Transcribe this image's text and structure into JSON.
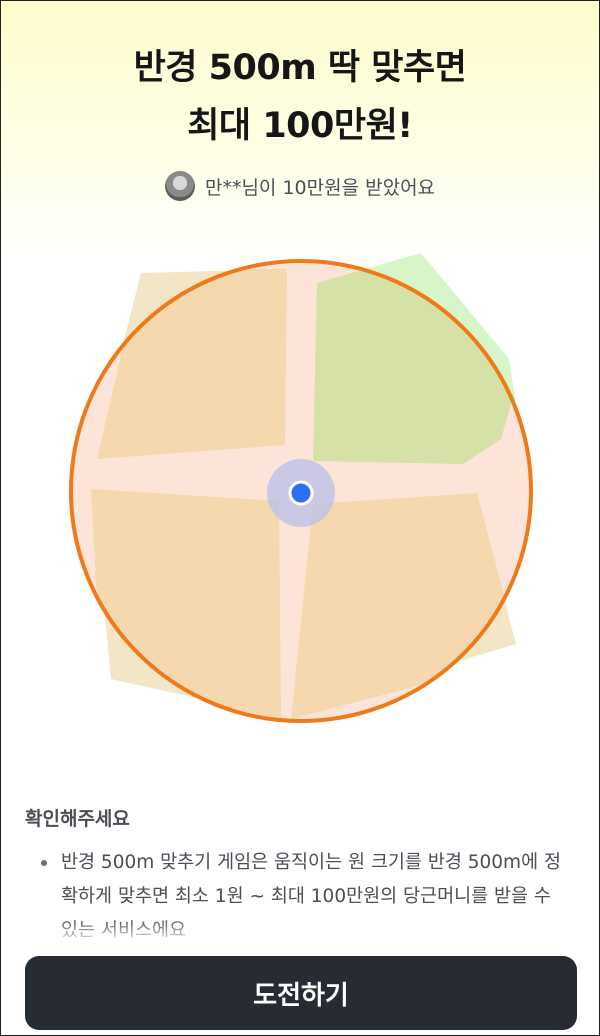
{
  "header": {
    "title_line1": "반경 500m 딱 맞추면",
    "title_line2": "최대 100만원!"
  },
  "winner": {
    "message": "만**님이 10만원을 받았어요"
  },
  "info": {
    "section_title": "확인해주세요",
    "notice": "반경 500m 맞추기 게임은 움직이는 원 크기를 반경 500m에 정확하게 맞추면 최소 1원 ~ 최대 100만원의 당근머니를 받을 수 있는 서비스에요"
  },
  "cta": {
    "label": "도전하기"
  },
  "colors": {
    "circle_stroke": "#f07a1a",
    "location_dot": "#2f6df2",
    "cta_background": "#272b33"
  }
}
